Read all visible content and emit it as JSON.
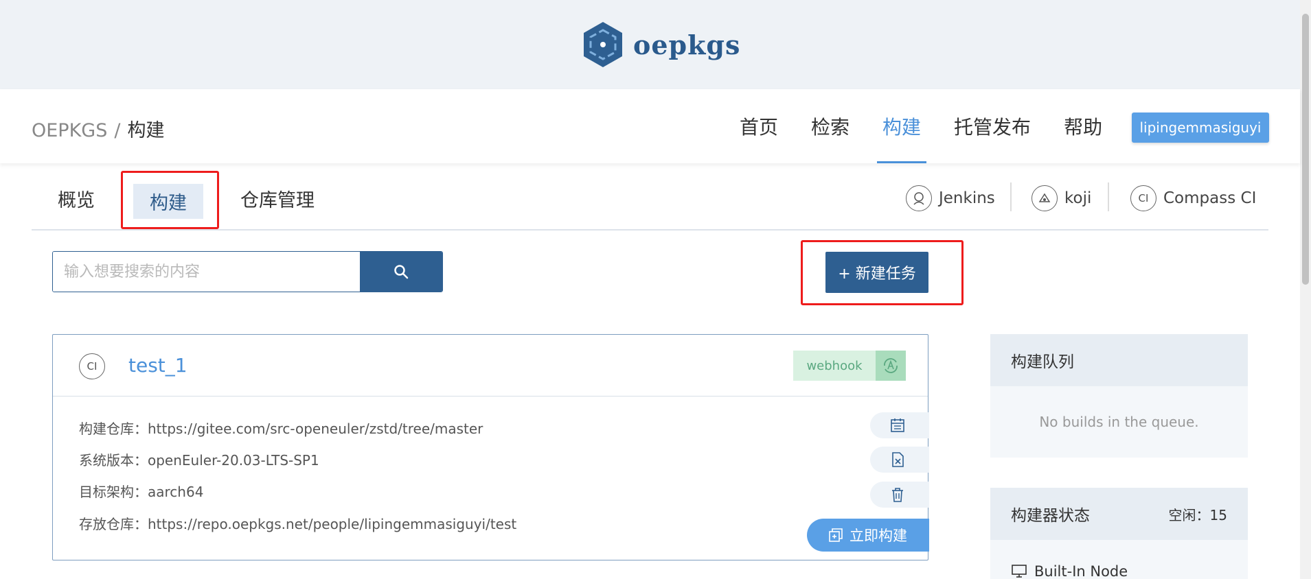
{
  "brand": {
    "name": "oepkgs"
  },
  "breadcrumb": {
    "root": "OEPKGS",
    "sep": "/",
    "current": "构建"
  },
  "nav": {
    "items": [
      {
        "label": "首页"
      },
      {
        "label": "检索"
      },
      {
        "label": "构建",
        "active": true
      },
      {
        "label": "托管发布"
      },
      {
        "label": "帮助"
      }
    ],
    "user": "lipingemmasiguyi"
  },
  "tabs": [
    {
      "label": "概览"
    },
    {
      "label": "构建",
      "active": true
    },
    {
      "label": "仓库管理"
    }
  ],
  "tools": [
    {
      "label": "Jenkins",
      "icon": "jenkins-icon"
    },
    {
      "label": "koji",
      "icon": "koji-icon"
    },
    {
      "label": "Compass CI",
      "icon": "ci-icon",
      "badge": "CI"
    }
  ],
  "search": {
    "placeholder": "输入想要搜索的内容"
  },
  "new_task": {
    "label": "+ 新建任务"
  },
  "job": {
    "badge": "CI",
    "name": "test_1",
    "trigger": "webhook",
    "rows": [
      {
        "key": "构建仓库：",
        "value": "https://gitee.com/src-openeuler/zstd/tree/master"
      },
      {
        "key": "系统版本：",
        "value": "openEuler-20.03-LTS-SP1"
      },
      {
        "key": "目标架构：",
        "value": "aarch64"
      },
      {
        "key": "存放仓库：",
        "value": "https://repo.oepkgs.net/people/lipingemmasiguyi/test"
      }
    ],
    "build_now": "立即构建"
  },
  "queue": {
    "title": "构建队列",
    "empty": "No builds in the queue."
  },
  "executors": {
    "title": "构建器状态",
    "idle_label": "空闲：",
    "idle_count": "15",
    "node": "Built-In Node"
  },
  "colors": {
    "primary": "#2e5f91",
    "accent": "#4a90d9",
    "highlight": "#ee1c1c",
    "webhook": "#d9f1e1"
  }
}
